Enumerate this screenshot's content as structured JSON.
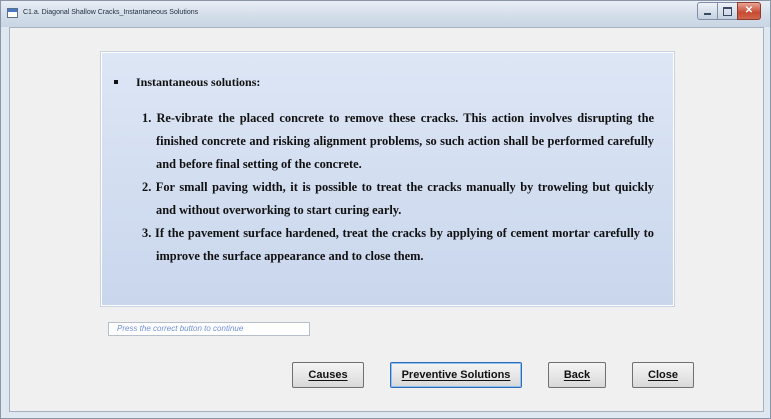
{
  "window": {
    "title": "C1.a. Diagonal Shallow Cracks_Instantaneous Solutions"
  },
  "content": {
    "heading": "Instantaneous solutions:",
    "items": [
      "1. Re-vibrate the placed concrete to remove these cracks. This action involves disrupting the finished concrete and risking alignment problems, so such action shall be performed carefully and before final setting of the concrete.",
      "2. For small paving width, it is possible to treat the cracks manually by troweling but quickly and without overworking to start curing early.",
      "3. If the pavement surface hardened, treat the cracks by applying of cement mortar carefully to improve the surface appearance and to close them."
    ]
  },
  "status": {
    "text": "Press the correct button to continue"
  },
  "buttons": {
    "causes": "Causes",
    "preventive": "Preventive Solutions",
    "back": "Back",
    "close": "Close"
  },
  "icons": {
    "app": "form-window-icon",
    "bullet": "square-bullet"
  }
}
